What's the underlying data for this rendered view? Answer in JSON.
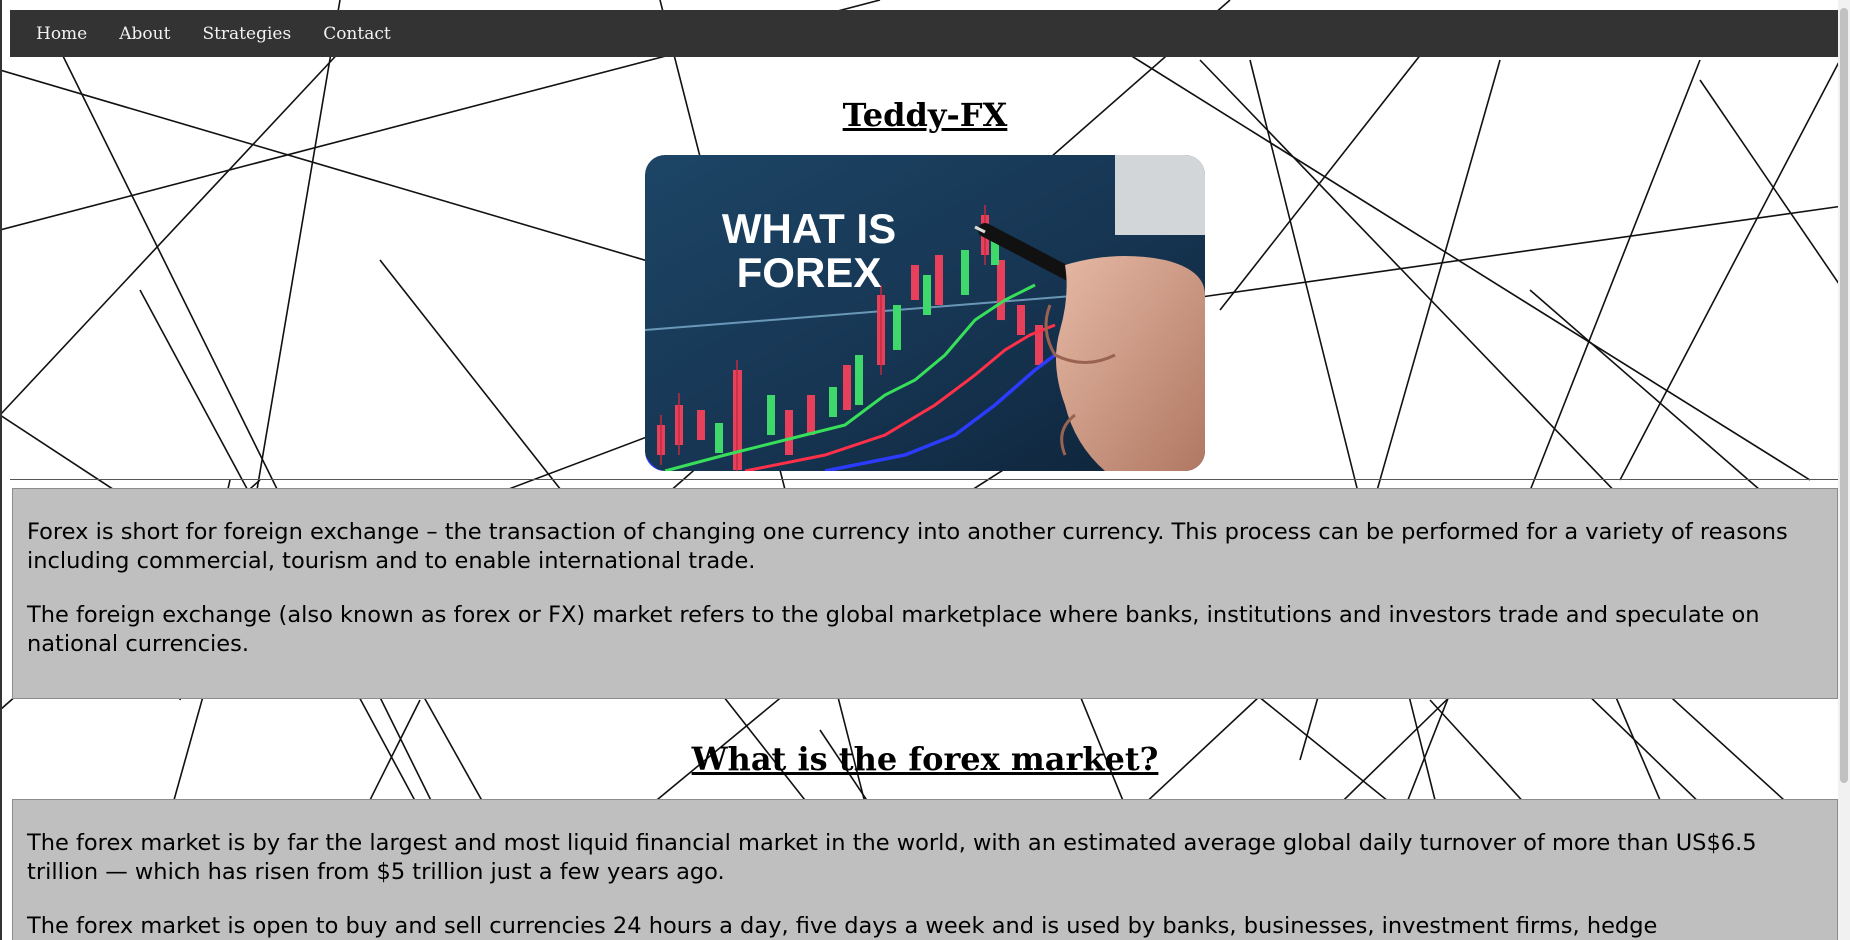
{
  "nav": {
    "items": [
      {
        "label": "Home"
      },
      {
        "label": "About"
      },
      {
        "label": "Strategies"
      },
      {
        "label": "Contact"
      }
    ]
  },
  "site_title": "Teddy-FX",
  "hero": {
    "line1": "WHAT IS",
    "line2": "FOREX"
  },
  "intro": {
    "paragraphs": [
      "Forex is short for foreign exchange – the transaction of changing one currency into another currency. This process can be performed for a variety of reasons including commercial, tourism and to enable international trade.",
      "The foreign exchange (also known as forex or FX) market refers to the global marketplace where banks, institutions and investors trade and speculate on national currencies."
    ]
  },
  "market_section": {
    "heading": "What is the forex market?",
    "paragraphs": [
      "The forex market is by far the largest and most liquid financial market in the world, with an estimated average global daily turnover of more than US$6.5 trillion — which has risen from $5 trillion just a few years ago.",
      "The forex market is open to buy and sell currencies 24 hours a day, five days a week and is used by banks, businesses, investment firms, hedge"
    ]
  }
}
